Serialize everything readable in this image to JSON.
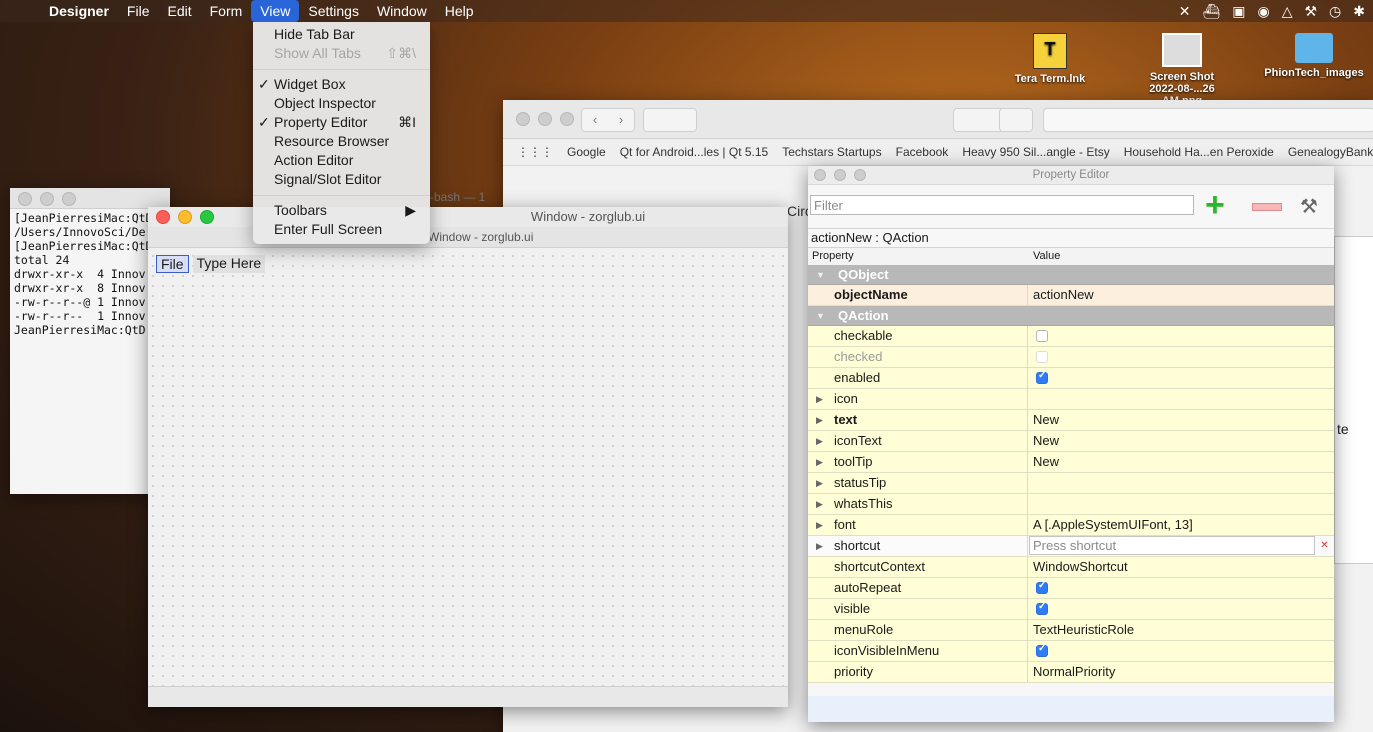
{
  "menubar": {
    "app": "Designer",
    "items": [
      "File",
      "Edit",
      "Form",
      "View",
      "Settings",
      "Window",
      "Help"
    ]
  },
  "desktop": {
    "icons": [
      {
        "label": "Tera Term.lnk",
        "label2": ""
      },
      {
        "label": "Screen Shot",
        "label2": "2022-08-...26 AM.png"
      },
      {
        "label": "PhionTech_images",
        "label2": ""
      }
    ]
  },
  "view_menu": {
    "items": [
      {
        "label": "Hide Tab Bar",
        "checked": false,
        "shortcut": "",
        "enabled": true
      },
      {
        "label": "Show All Tabs",
        "checked": false,
        "shortcut": "⇧⌘\\",
        "enabled": false
      },
      {
        "label": "Widget Box",
        "checked": true,
        "shortcut": "",
        "enabled": true
      },
      {
        "label": "Object Inspector",
        "checked": false,
        "shortcut": "",
        "enabled": true
      },
      {
        "label": "Property Editor",
        "checked": true,
        "shortcut": "⌘I",
        "enabled": true
      },
      {
        "label": "Resource Browser",
        "checked": false,
        "shortcut": "",
        "enabled": true
      },
      {
        "label": "Action Editor",
        "checked": false,
        "shortcut": "",
        "enabled": true
      },
      {
        "label": "Signal/Slot Editor",
        "checked": false,
        "shortcut": "",
        "enabled": true
      },
      {
        "label": "Toolbars",
        "checked": false,
        "shortcut": "▶",
        "enabled": true
      },
      {
        "label": "Enter Full Screen",
        "checked": false,
        "shortcut": "",
        "enabled": true
      }
    ]
  },
  "terminal": {
    "tab_title": "-bash — 1",
    "lines": [
      "[JeanPierresiMac:QtD",
      "/Users/InnovoSci/De",
      "[JeanPierresiMac:QtD",
      "total 24",
      "drwxr-xr-x  4 Innov",
      "drwxr-xr-x  8 Innov",
      "-rw-r--r--@ 1 Innov",
      "-rw-r--r--  1 Innov",
      "JeanPierresiMac:QtD"
    ]
  },
  "browser": {
    "bookmarks": [
      "Google",
      "Qt for Android...les | Qt 5.15",
      "Techstars Startups",
      "Facebook",
      "Heavy 950 Sil...angle - Etsy",
      "Household Ha...en Peroxide",
      "GenealogyBank | Face"
    ],
    "partial_text": "Circ",
    "partial_text2": "te"
  },
  "form": {
    "title": "Window - zorglub.ui",
    "subtitle": "Window - zorglub.ui",
    "menu_file": "File",
    "menu_typehere": "Type Here"
  },
  "property_editor": {
    "title": "Property Editor",
    "filter_placeholder": "Filter",
    "object_line": "actionNew : QAction",
    "col_property": "Property",
    "col_value": "Value",
    "rows": [
      {
        "kind": "cat",
        "name": "QObject"
      },
      {
        "kind": "prop",
        "name": "objectName",
        "value": "actionNew",
        "bold": true,
        "bg": "peach"
      },
      {
        "kind": "cat",
        "name": "QAction"
      },
      {
        "kind": "prop",
        "name": "checkable",
        "check": false,
        "bg": "yellow"
      },
      {
        "kind": "prop",
        "name": "checked",
        "check": false,
        "dim": true,
        "bg": "yellow"
      },
      {
        "kind": "prop",
        "name": "enabled",
        "check": true,
        "bg": "yellow"
      },
      {
        "kind": "prop",
        "name": "icon",
        "value": "",
        "expand": true,
        "bg": "yellow"
      },
      {
        "kind": "prop",
        "name": "text",
        "value": "New",
        "bold": true,
        "expand": true,
        "bg": "yellow"
      },
      {
        "kind": "prop",
        "name": "iconText",
        "value": "New",
        "expand": true,
        "bg": "yellow"
      },
      {
        "kind": "prop",
        "name": "toolTip",
        "value": "New",
        "expand": true,
        "bg": "yellow"
      },
      {
        "kind": "prop",
        "name": "statusTip",
        "value": "",
        "expand": true,
        "bg": "yellow"
      },
      {
        "kind": "prop",
        "name": "whatsThis",
        "value": "",
        "expand": true,
        "bg": "yellow"
      },
      {
        "kind": "prop",
        "name": "font",
        "value": "A    [.AppleSystemUIFont, 13]",
        "expand": true,
        "bg": "yellow"
      },
      {
        "kind": "shortcut",
        "name": "shortcut",
        "placeholder": "Press shortcut",
        "expand": true
      },
      {
        "kind": "prop",
        "name": "shortcutContext",
        "value": "WindowShortcut",
        "bg": "yellow"
      },
      {
        "kind": "prop",
        "name": "autoRepeat",
        "check": true,
        "bg": "yellow"
      },
      {
        "kind": "prop",
        "name": "visible",
        "check": true,
        "bg": "yellow"
      },
      {
        "kind": "prop",
        "name": "menuRole",
        "value": "TextHeuristicRole",
        "bg": "yellow"
      },
      {
        "kind": "prop",
        "name": "iconVisibleInMenu",
        "check": true,
        "bg": "yellow"
      },
      {
        "kind": "prop",
        "name": "priority",
        "value": "NormalPriority",
        "bg": "yellow"
      }
    ]
  },
  "colors": {
    "menu_highlight": "#2a64d9",
    "category_bg": "#b8b8b8",
    "row_yellow": "#fffed6",
    "row_peach": "#fdefde",
    "checkbox_on": "#2f7cf6"
  }
}
